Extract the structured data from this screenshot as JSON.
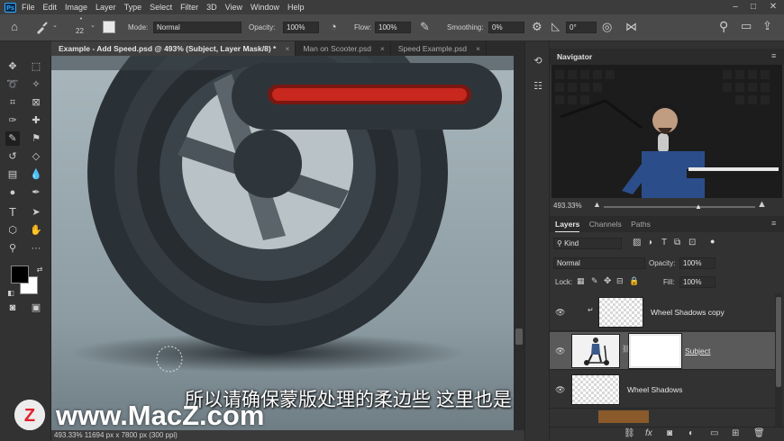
{
  "menubar": {
    "logo": "Ps",
    "items": [
      "File",
      "Edit",
      "Image",
      "Layer",
      "Type",
      "Select",
      "Filter",
      "3D",
      "View",
      "Window",
      "Help"
    ]
  },
  "options": {
    "brush_size": "22",
    "mode_label": "Mode:",
    "mode_value": "Normal",
    "opacity_label": "Opacity:",
    "opacity_value": "100%",
    "flow_label": "Flow:",
    "flow_value": "100%",
    "smoothing_label": "Smoothing:",
    "smoothing_value": "0%",
    "angle_value": "0°"
  },
  "tabs": [
    {
      "label": "Example - Add Speed.psd @ 493% (Subject, Layer Mask/8) *",
      "close": "×"
    },
    {
      "label": "Man on Scooter.psd",
      "close": "×"
    },
    {
      "label": "Speed Example.psd",
      "close": "×"
    }
  ],
  "status": {
    "text": "493.33%   11694 px x 7800 px (300 ppi)"
  },
  "navigator": {
    "title": "Navigator",
    "zoom": "493.33%"
  },
  "layers_panel": {
    "tabs": [
      "Layers",
      "Channels",
      "Paths"
    ],
    "filter_kind": "Kind",
    "blend_mode": "Normal",
    "opacity_label": "Opacity:",
    "opacity_value": "100%",
    "lock_label": "Lock:",
    "fill_label": "Fill:",
    "fill_value": "100%",
    "layers": [
      {
        "name": "Wheel Shadows copy"
      },
      {
        "name": "Subject"
      },
      {
        "name": "Wheel Shadows"
      }
    ],
    "footer_icons": [
      "link-icon",
      "fx-icon",
      "mask-icon",
      "adjustment-icon",
      "group-icon",
      "new-layer-icon",
      "trash-icon"
    ]
  },
  "overlay": {
    "subtitle": "所以请确保蒙版处理的柔边些 这里也是",
    "watermark": "www.MacZ.com",
    "watermark_logo": "Z"
  },
  "colors": {
    "accent": "#31a8ff",
    "canvas_red": "#c8281e"
  }
}
